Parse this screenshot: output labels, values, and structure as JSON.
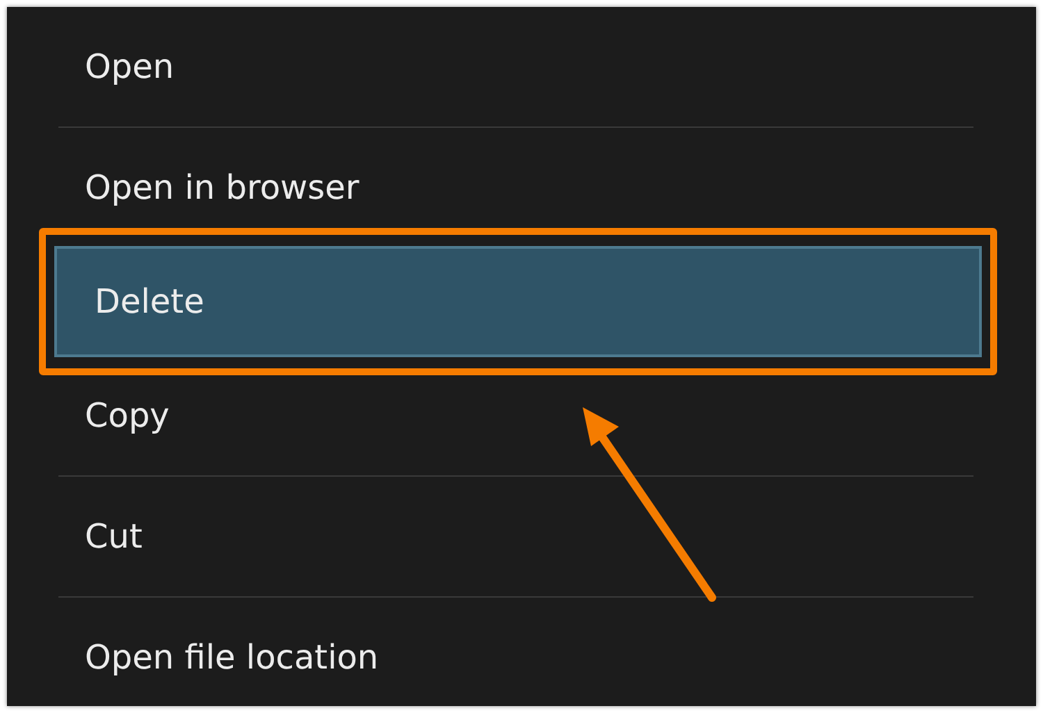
{
  "menu": {
    "items": [
      {
        "label": "Open",
        "selected": false
      },
      {
        "label": "Open in browser",
        "selected": false
      },
      {
        "label": "Delete",
        "selected": true
      },
      {
        "label": "Copy",
        "selected": false
      },
      {
        "label": "Cut",
        "selected": false
      },
      {
        "label": "Open file location",
        "selected": false
      }
    ]
  }
}
